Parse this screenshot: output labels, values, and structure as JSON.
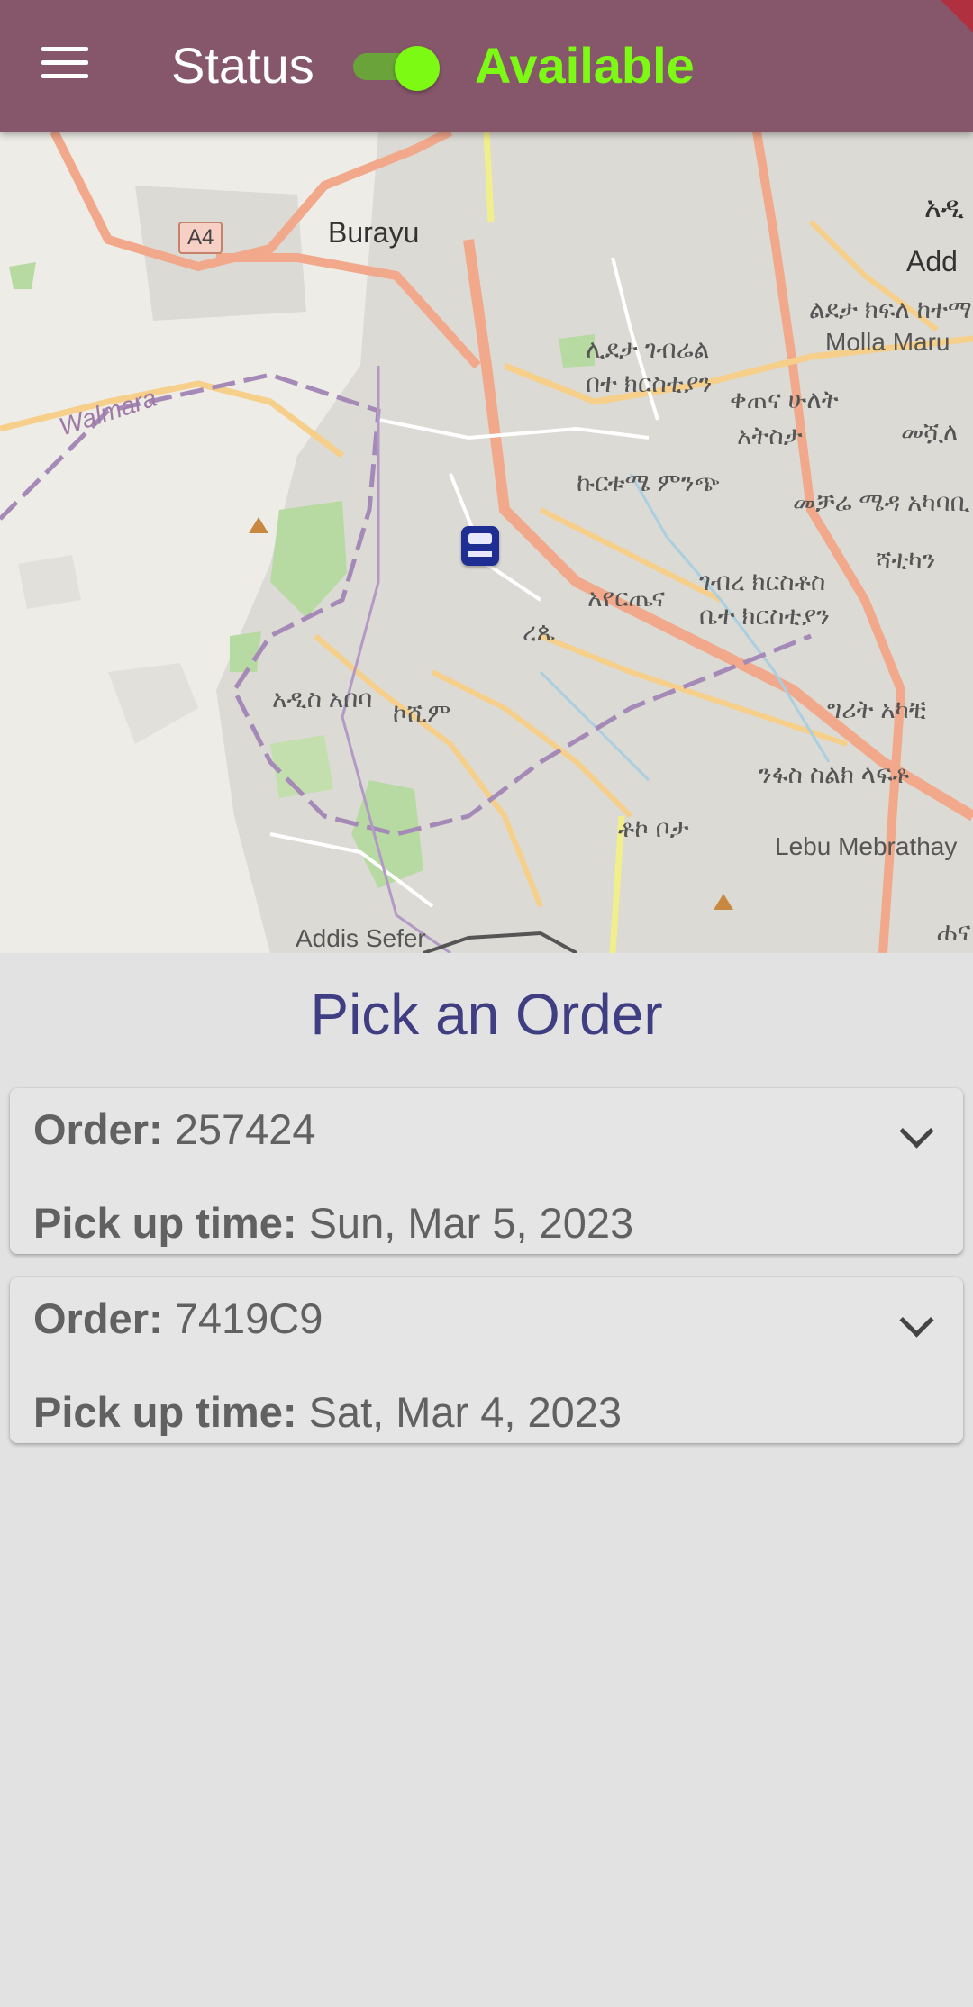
{
  "appbar": {
    "menu_icon": "hamburger-menu-icon",
    "status_label": "Status",
    "availability_text": "Available",
    "toggle_on": true,
    "colors": {
      "bar": "#86566a",
      "accent": "#7cfa14"
    }
  },
  "map": {
    "labels": {
      "burayu": "Burayu",
      "a4": "A4",
      "walmara": "Walmara",
      "addis_sefer": "Addis Sefer",
      "molla_maru": "Molla Maru",
      "lebu": "Lebu Mebrathay",
      "addis": "Add",
      "amh_1": "ሊደታ ገብሬል",
      "amh_2": "በተ ክርስቲያን",
      "amh_3": "ቀጠና ሁለት",
      "amh_4": "አትስታ",
      "amh_5": "ኩርቱሜ ምንጭ",
      "amh_6": "አየርጤና",
      "amh_7": "ገብረ ክርስቶስ",
      "amh_8": "ቤተ ክርስቲያን",
      "amh_9": "ረጴ",
      "amh_10": "አዲስ አበባ",
      "amh_11": "ኮሺም",
      "amh_12": "ቶኮ ቦታ",
      "amh_13": "ንፋስ ስልክ ላፍቶ",
      "amh_14": "ግሪት አካቺ",
      "amh_15": "መቻሬ ሜዳ አካባቢ",
      "amh_16": "ልደታ ክፍለ ከተማ",
      "amh_17": "ሻቲካን",
      "amh_18": "መሿለ",
      "amh_19": "ሐና",
      "amh_20": "አዲ"
    },
    "vehicle_icon": "bus-icon"
  },
  "orders": {
    "title": "Pick an Order",
    "order_label": "Order:",
    "pickup_label": "Pick up time:",
    "items": [
      {
        "id": "257424",
        "pickup_time": "Sun, Mar 5, 2023"
      },
      {
        "id": "7419C9",
        "pickup_time": "Sat, Mar 4, 2023"
      }
    ]
  }
}
